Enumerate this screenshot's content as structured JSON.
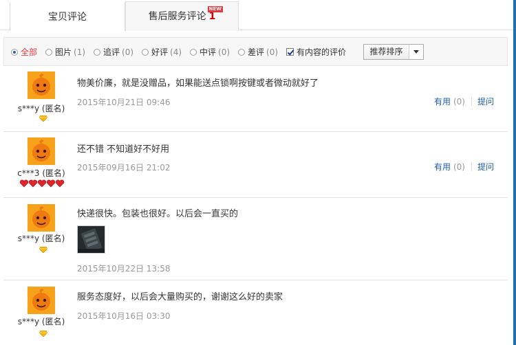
{
  "tabs": {
    "reviews": "宝贝评论",
    "after_sales": "售后服务评论",
    "after_sales_count": "1",
    "new_badge": "NEW"
  },
  "filters": {
    "all": "全部",
    "images": "图片",
    "images_count": "(1)",
    "followup": "追评",
    "followup_count": "(0)",
    "good": "好评",
    "good_count": "(4)",
    "neutral": "中评",
    "neutral_count": "(0)",
    "bad": "差评",
    "bad_count": "(0)",
    "with_content": "有内容的评价",
    "sort_label": "推荐排序"
  },
  "actions": {
    "useful": "有用",
    "reply": "提问"
  },
  "reviews": [
    {
      "user": "s***y (匿名)",
      "rank_icon": "yellow-diamond",
      "content": "物美价廉，就是没赠品，如果能送点锁啊按键或者微动就好了",
      "date": "2015年10月21日 09:46",
      "useful_count": "(0)"
    },
    {
      "user": "c***3 (匿名)",
      "rank_icon": "red-hearts-x5",
      "content": "还不错 不知道好不好用",
      "date": "2015年09月16日 21:02",
      "useful_count": "(0)"
    },
    {
      "user": "s***y (匿名)",
      "rank_icon": "yellow-diamond",
      "content": "快递很快。包装也很好。以后会一直买的",
      "date": "2015年10月22日 13:58"
    },
    {
      "user": "s***y (匿名)",
      "rank_icon": "yellow-diamond",
      "content": "服务态度好，以后会大量购买的，谢谢这么好的卖家",
      "date": "2015年10月16日 03:30"
    }
  ],
  "colors": {
    "accent_red": "#e4393c",
    "link_blue": "#1f5fa8",
    "avatar_orange": "#f28a12"
  }
}
